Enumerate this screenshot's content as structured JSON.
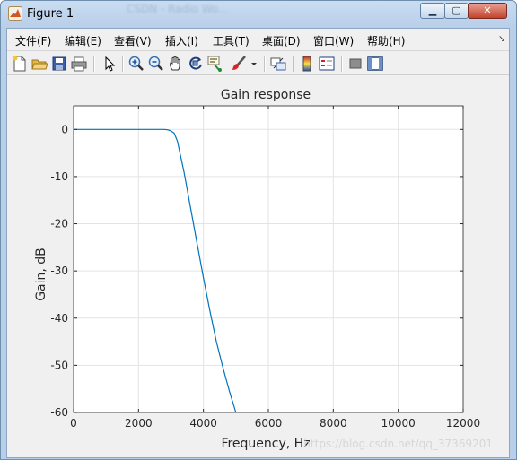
{
  "window": {
    "title": "Figure 1",
    "background_text": "CSDN - Radio Wo..."
  },
  "menu": [
    {
      "label": "文件(F)"
    },
    {
      "label": "编辑(E)"
    },
    {
      "label": "查看(V)"
    },
    {
      "label": "插入(I)"
    },
    {
      "label": "工具(T)"
    },
    {
      "label": "桌面(D)"
    },
    {
      "label": "窗口(W)"
    },
    {
      "label": "帮助(H)"
    }
  ],
  "toolbar": {
    "icons": [
      "new-figure-icon",
      "open-file-icon",
      "save-icon",
      "print-icon",
      "pointer-icon",
      "zoom-in-icon",
      "zoom-out-icon",
      "pan-icon",
      "rotate-3d-icon",
      "data-cursor-icon",
      "brush-icon",
      "link-plot-icon",
      "colorbar-icon",
      "legend-icon",
      "hide-plot-tools-icon",
      "show-plot-tools-icon"
    ]
  },
  "chart_data": {
    "type": "line",
    "title": "Gain response",
    "xlabel": "Frequency, Hz",
    "ylabel": "Gain, dB",
    "xlim": [
      0,
      12000
    ],
    "ylim": [
      -60,
      5
    ],
    "xticks": [
      0,
      2000,
      4000,
      6000,
      8000,
      10000,
      12000
    ],
    "yticks": [
      0,
      -10,
      -20,
      -30,
      -40,
      -50,
      -60
    ],
    "grid": true,
    "line_color": "#0072bd",
    "x": [
      0,
      2800,
      2900,
      3000,
      3100,
      3200,
      3400,
      3600,
      3800,
      4000,
      4200,
      4400,
      4600,
      4800,
      5000
    ],
    "y": [
      0,
      0,
      -0.1,
      -0.3,
      -0.8,
      -2.5,
      -9,
      -16.5,
      -24,
      -31.5,
      -38.5,
      -45,
      -50.5,
      -55.5,
      -60
    ]
  },
  "watermark": "https://blog.csdn.net/qq_37369201"
}
